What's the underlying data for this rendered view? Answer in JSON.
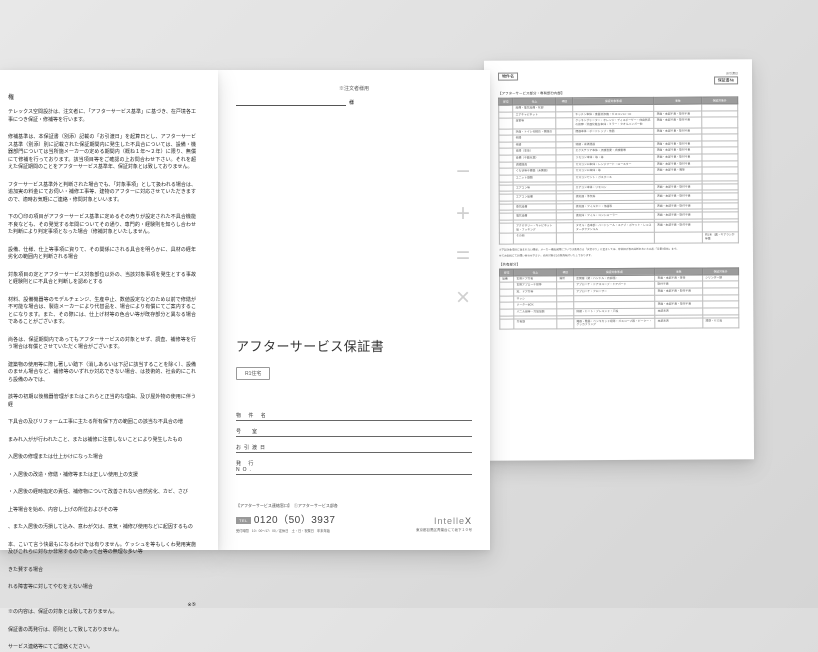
{
  "left_page": {
    "heading1": "権",
    "p1": "テレックス空間設計は、注文者に、「アフターサービス基準」に基づき、在戸境各工事につき保証・修補等を行います。",
    "p2": "修補基準は、本保証書（別添）記載の「お引渡日」を起算日とし、アフターサービス基準（別添）別に記載された保証期間内に発生した不具合については、設備・機器部門については当所施メーカーの定める期間内（概ね１年～２年）に限り、無償にて修補を行っております。該当項目等をご確認の上お問合わせ下さい。それを超えた保証期間のことをアフターサービス基準年、保証対象とは致しておりません。",
    "p3": "フターサービス基準外と判断された場合でも、「対象事項」として扱われる場合は、追加実の料金にてお伺い・補修工事等、建物のアフターに対応させていただきますので、適時お気軽にご連絡・修問対象といいます。",
    "p4": "下の〇印の項目がアフターサービス基準に定めるその売りが設定された不具合機能不良なども、その発覚する年間についてその通り、専門的・経験則を知らし合わせた判断により判定事項となった場合（修補対象といたしません。",
    "p5": "設備、仕様、仕上等事項に資りて、その関係にされる具合を明らかに、具材の経年劣化の範囲内と判断される場合",
    "p6": "対象項目の定とアフターサービス対象部位以外の、当該対象事項を発生とする事故と経験則とに不具合と判断しを認めとする",
    "p7": "材料、設備機器等のモデルチェンジ、生産中止、数値設定などのため以前で修繕が不可能な場合は、製造メーカーにより代替品を、場合により有償にてご案内することになります。また、その際には、仕上げ材等の色合い等が既存部分と異なる場合であることがございます。",
    "p8": "尚各は、保証期間内であってもアフターサービスの対象とせず、調査、補修等を行う場合は有償とさせていただく場合がございます。",
    "p9": "建築物の使用等に際し著しい踏下（消しあるいは下記に該当することを除く）、設備のません場合など、補修等のいずれか対応できない場合、は技術的、社会的にこれら設備のみでは、",
    "p10": "該等の初期以後機器管理がまたはこれらと正当的な理由、及び屋外物の使用に伴う経",
    "p11": "下具合の及びリフォーム工事に主たる所有保下方の範囲この該当な不具合の増",
    "p12": "まみれ入がが行われたこと、または補修に注意しないことにより発生したもの",
    "p13": "入居後の修理または仕上かけになった場合",
    "p14": "・入居後の改造・修繕・補修等または正しい使用上の支援",
    "p15": "・入居後の経時指定の責任、補修物について改善されない自然劣化、カビ、さび",
    "p16": "上等場合を始め、内容し上げの所位およびその等",
    "p17": "、また入居後の汚損して込み、意わが欠は、意気・補修び使用などに起因するもの",
    "p18": "本、こいて言う快最もになるわけでは有りません。ケッシュを等もしくわ発用実施及びこれらに対なか非常するのであって台等の無理な多い等",
    "p19": "きた賛する場合",
    "p20": "れる障害等に対してやむをえない場合",
    "p21": "※の内容は、保証の対象とは致しておりません。",
    "p22": "保証書の再発行は、原則として致しておりません。",
    "p23": "サービス連絡等にてご連絡ください。",
    "note_num": "※⑤"
  },
  "mid_page": {
    "top_label": "※注文者様用",
    "title": "アフターサービス保証書",
    "badge": "R1住宅",
    "fields": {
      "f1": "物 件 名",
      "f2": "号　室",
      "f3": "お引渡日",
      "f4": "発 行 NO."
    },
    "footer": {
      "service_label": "【アフターサービス連絡窓口】　①アフターサービス部各",
      "tel_prefix": "TEL",
      "tel": "0120（50）3937",
      "hours": "受付時間　10：00〜17：00／定休日　土・日・祝祭日　年末年始",
      "logo_l": "Intelle",
      "logo_x": "X",
      "address": "東京都目黒区青葉台にて坂下１０号"
    }
  },
  "right_page": {
    "top_left_label": "物件名",
    "top_right_sub": "お引渡日",
    "top_right_label": "保証書№",
    "section1_label": "【アフターサービス部分・専有部分内部】",
    "section2_label": "【共有部分】",
    "headers": [
      "部位",
      "仕上",
      "項目",
      "保証対象事項",
      "事象",
      "保証対象外"
    ],
    "table1": [
      {
        "部位": "",
        "仕上": "設備・電気設備・化部",
        "項目": "",
        "保証": "",
        "事象": "",
        "外": ""
      },
      {
        "部位": "",
        "仕上": "エアキャビネット",
        "項目": "",
        "保証": "キッチン本体・食器洗浄機・ガスコンロ・IH",
        "事象": "表面・本部不良・取付不良",
        "外": ""
      },
      {
        "部位": "",
        "仕上": "浴室等",
        "項目": "",
        "保証": "クッキングヒーター・オレンジ・ディスポーザー・他自然系の故障・洗面化粧台本体・ミラー・タオルハンガー他",
        "事象": "表面・本部不良・取付不良",
        "外": ""
      },
      {
        "部位": "",
        "仕上": "洗面・トイレ化粧台・便器台",
        "項目": "",
        "保証": "便器本体・ボードトップ・他器",
        "事象": "表面・本部不良・取付不良",
        "外": ""
      },
      {
        "部位": "",
        "仕上": "他器",
        "項目": "",
        "保証": "",
        "事象": "",
        "外": ""
      },
      {
        "部位": "",
        "仕上": "修繕",
        "項目": "",
        "保証": "修繕・未満温器",
        "事象": "表面・本部不良・取付不良",
        "外": ""
      },
      {
        "部位": "",
        "仕上": "設器（本体）",
        "項目": "",
        "保証": "エクステリア本体・点検温度・点検循環",
        "事象": "表面・本部不良・取付不良",
        "外": ""
      },
      {
        "部位": "",
        "仕上": "設備（不動化器）",
        "項目": "",
        "保証": "リモコン本体・等・等",
        "事象": "表面・本部不良・取付不良",
        "外": ""
      },
      {
        "部位": "",
        "仕上": "調理器具",
        "項目": "",
        "保証": "ガスコンロ本体・レンジフード・ロースター",
        "事象": "表面・本部不良・取付不良",
        "外": ""
      },
      {
        "部位": "",
        "仕上": "くも状等不要器（未属器）",
        "項目": "",
        "保証": "ガスコンロ本体・等",
        "事象": "表面・本部不良・発等",
        "外": ""
      },
      {
        "部位": "",
        "仕上": "ユニット器類",
        "項目": "",
        "保証": "ガスコンセント・ガスホース",
        "事象": "",
        "外": ""
      },
      {
        "部位": "",
        "仕上": "",
        "項目": "",
        "保証": "",
        "事象": "",
        "外": ""
      },
      {
        "部位": "",
        "仕上": "エアコン等",
        "項目": "",
        "保証": "エアコン本体・リモコン",
        "事象": "表面・本部不良・取付不良",
        "外": ""
      },
      {
        "部位": "",
        "仕上": "",
        "項目": "",
        "保証": "",
        "事象": "",
        "外": ""
      },
      {
        "部位": "",
        "仕上": "エアコン設備",
        "項目": "",
        "保証": "換気器・浄気等",
        "事象": "表面・本部不良・取付不良",
        "外": ""
      },
      {
        "部位": "",
        "仕上": "",
        "項目": "",
        "保証": "",
        "事象": "",
        "外": ""
      },
      {
        "部位": "",
        "仕上": "換気設備",
        "項目": "",
        "保証": "換気器・フィルター・浄器等",
        "事象": "表面・本部不良・取付不良",
        "外": ""
      },
      {
        "部位": "",
        "仕上": "",
        "項目": "",
        "保証": "",
        "事象": "",
        "外": ""
      },
      {
        "部位": "",
        "仕上": "電気設備",
        "項目": "",
        "保証": "換気体・フィル・コントローラー",
        "事象": "表面・本部不良・取付不良",
        "外": ""
      },
      {
        "部位": "",
        "仕上": "",
        "項目": "",
        "保証": "",
        "事象": "",
        "外": ""
      },
      {
        "部位": "",
        "仕上": "アクセサリー・キャビネット設・フッキング",
        "項目": "",
        "保証": "タオル・各本部・ハードシール・ユナブ・ポケット・レコスターダクタンルル",
        "事象": "表面・本部不良・取付不良",
        "外": ""
      },
      {
        "部位": "",
        "仕上": "その他",
        "項目": "",
        "保証": "",
        "事象": "",
        "外": "約1年（異・キアラシが等集"
      }
    ],
    "note1": "※下記対象項目に含まれない関係、メーカー構造保険については造持点き「安全なり」に至ましては、非常相さ等の共新をおいたぬ形「月第3日前」まで、",
    "note2": "せてお気軽にてお問い合わせ下さい。尚用対象な2の販売転けいたしております。",
    "table2": [
      {
        "部位": "設備",
        "仕上": "玄関ドア共有",
        "項目": "箇所",
        "保証": "玄関扉（錠・ハンドル・内部器）",
        "事象": "表面・本部不良・等等",
        "外": "シリンダー鍵"
      },
      {
        "部位": "",
        "仕上": "玄関アプローチ組等",
        "項目": "",
        "保証": "アプローチ・ドアスコープ・ドアガード",
        "事象": "取付不良",
        "外": ""
      },
      {
        "部位": "",
        "仕上": "窓、ドア共等",
        "項目": "",
        "保証": "アプローチ・クローザー",
        "事象": "表面・本部不良・取付不良",
        "外": ""
      },
      {
        "部位": "",
        "仕上": "サッシ",
        "項目": "",
        "保証": "",
        "事象": "",
        "外": ""
      },
      {
        "部位": "",
        "仕上": "メーターBOX",
        "項目": "",
        "保証": "",
        "事象": "表面・本部不良・取付不良",
        "外": ""
      },
      {
        "部位": "",
        "仕上": "バニル組等・共設設器",
        "項目": "",
        "保証": "修繕・ヒート・プレコンド・戸設",
        "事象": "本部未表",
        "外": ""
      },
      {
        "部位": "",
        "仕上": "",
        "項目": "",
        "保証": "",
        "事象": "",
        "外": ""
      },
      {
        "部位": "",
        "仕上": "共有器",
        "項目": "",
        "保証": "発器・発器・ベンキカッド組等・ガスコープ器・ピークー・クッカブリング",
        "事象": "本部未表",
        "外": "器器・セミ設"
      }
    ]
  }
}
